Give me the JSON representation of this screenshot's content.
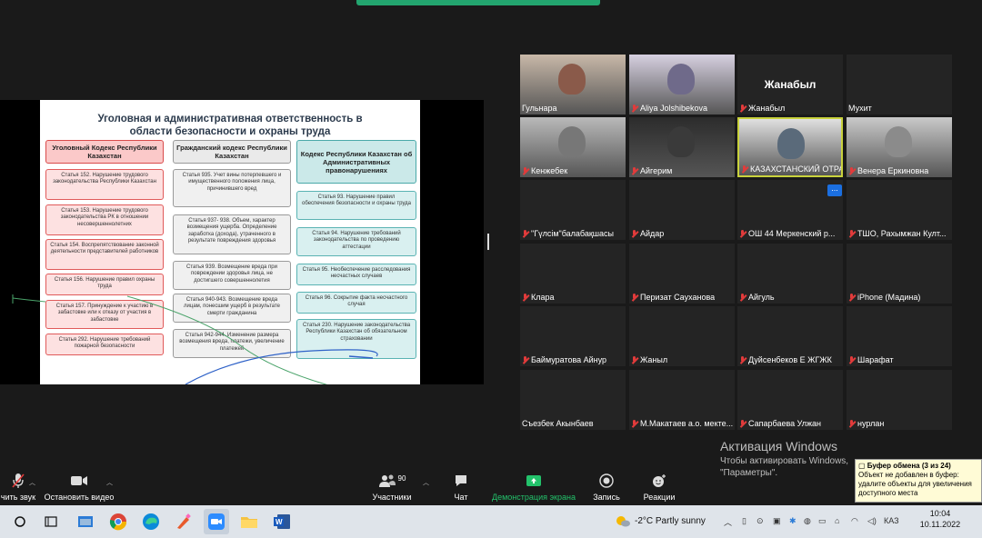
{
  "slide": {
    "title": "Уголовная и административная ответственность в области безопасности и охраны труда",
    "headers": [
      "Уголовный Кодекс Республики Казахстан",
      "Гражданский кодекс Республики Казахстан",
      "Кодекс Республики Казахстан об Административных правонарушениях"
    ],
    "col1": [
      "Статья 152. Нарушение трудового законодательства Республики Казахстан",
      "Статья 153. Нарушение трудового законодательства РК в отношении несовершеннолетних",
      "Статья 154. Воспрепятствование законной деятельности представителей работников",
      "Статья 156. Нарушение правил охраны труда",
      "Статья 157. Принуждение к участию в забастовке или к отказу от участия в забастовке",
      "Статья 292. Нарушение требований пожарной безопасности"
    ],
    "col2": [
      "Статья 935. Учет вины потерпевшего и имущественного положения лица, причинившего вред",
      "Статья 937- 938. Объем, характер возмещения ущерба. Определение заработка (дохода), утраченного в результате повреждения здоровья",
      "Статья 939. Возмещение вреда при повреждении здоровья лица, не достигшего совершеннолетия",
      "Статья 940-943. Возмещение вреда лицам, понесшим ущерб в результате смерти гражданина",
      "Статья 942-944. Изменение размера возмещения вреда, платежи, увеличение платежей"
    ],
    "col3": [
      "Статья 93. Нарушение правил обеспечения безопасности и охраны труда",
      "Статья 94. Нарушение требований законодательства по проведению аттестации",
      "Статья 95. Необеспечение расследования несчастных случаев",
      "Статья 96. Сокрытие факта несчастного случая",
      "Статья 230. Нарушение законодательства Республики Казахстан об обязательном страховании"
    ]
  },
  "participants": [
    {
      "name": "Гульнара",
      "muted": false,
      "video": true
    },
    {
      "name": "Aliya Jolshibekova",
      "muted": true,
      "video": true
    },
    {
      "name": "Жанабыл",
      "muted": true,
      "video": false,
      "big": "Жанабыл"
    },
    {
      "name": "Мухит",
      "muted": false,
      "video": false
    },
    {
      "name": "Кенжебек",
      "muted": true,
      "video": true
    },
    {
      "name": "Айгерим",
      "muted": true,
      "video": true
    },
    {
      "name": "КАЗАХСТАНСКИЙ ОТРАС...",
      "muted": true,
      "video": true,
      "active": true
    },
    {
      "name": "Венера Еркиновна",
      "muted": true,
      "video": true
    },
    {
      "name": "\"Гүлсім\"балабақшасы",
      "muted": true,
      "video": false
    },
    {
      "name": "Айдар",
      "muted": true,
      "video": false
    },
    {
      "name": "ОШ 44 Меркенский р...",
      "muted": true,
      "video": false
    },
    {
      "name": "ТШО, Рахымжан Култ...",
      "muted": true,
      "video": false
    },
    {
      "name": "Клара",
      "muted": true,
      "video": false
    },
    {
      "name": "Перизат Сауханова",
      "muted": true,
      "video": false
    },
    {
      "name": "Айгуль",
      "muted": true,
      "video": false
    },
    {
      "name": "iPhone (Мадина)",
      "muted": true,
      "video": false
    },
    {
      "name": "Баймуратова Айнур",
      "muted": true,
      "video": false
    },
    {
      "name": "Жаныл",
      "muted": true,
      "video": false
    },
    {
      "name": "Дуйсенбеков Е ЖГЖК",
      "muted": true,
      "video": false
    },
    {
      "name": "Шарафат",
      "muted": true,
      "video": false
    },
    {
      "name": "Съезбек Акынбаев",
      "muted": false,
      "video": false
    },
    {
      "name": "М.Макатаев а.о. мекте...",
      "muted": true,
      "video": false
    },
    {
      "name": "Сапарбаева Улжан",
      "muted": true,
      "video": false
    },
    {
      "name": "нурлан",
      "muted": true,
      "video": false
    }
  ],
  "more_button": "...",
  "toolbar": {
    "unmute": "чить звук",
    "video": "Остановить видео",
    "participants": "Участники",
    "participants_count": "90",
    "chat": "Чат",
    "share": "Демонстрация экрана",
    "record": "Запись",
    "reactions": "Реакции",
    "colors": {
      "share": "#23c26b"
    }
  },
  "activation": {
    "line1": "Активация Windows",
    "line2": "Чтобы активировать Windows,",
    "line3": "\"Параметры\"."
  },
  "clipboard": {
    "title": "Буфер обмена (3 из 24)",
    "text": "Объект не добавлен в буфер: удалите объекты для увеличения доступного места"
  },
  "taskbar": {
    "weather": "-2°C  Partly sunny",
    "lang": "КАЗ",
    "time": "10:04",
    "date": "10.11.2022"
  }
}
